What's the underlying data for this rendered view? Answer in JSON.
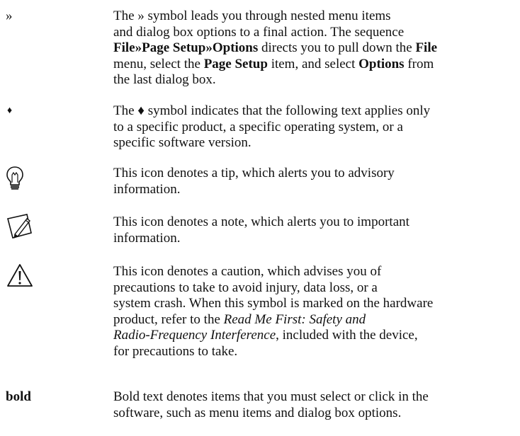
{
  "rows": [
    {
      "label": "»",
      "text": [
        "The » symbol leads you through nested menu items",
        "and dialog box options to a final action. The sequence",
        "File»Page Setup»Options directs you to pull down the File",
        "menu, select the Page Setup item, and select Options from",
        "the last dialog box."
      ]
    },
    {
      "label": "♦",
      "text": [
        "The ♦ symbol indicates that the following text applies only",
        "to a specific product, a specific operating system, or a",
        "specific software version."
      ]
    },
    {
      "icon": "tip-lightbulb-icon",
      "text": [
        "This icon denotes a tip, which alerts you to advisory",
        "information."
      ]
    },
    {
      "icon": "note-pencil-icon",
      "text": [
        "This icon denotes a note, which alerts you to important",
        "information."
      ]
    },
    {
      "icon": "caution-warning-icon",
      "text": [
        "This icon denotes a caution, which advises you of",
        "precautions to take to avoid injury, data loss, or a",
        "system crash. When this symbol is marked on the hardware",
        "product, refer to the Read Me First: Safety and",
        "Radio-Frequency Interference, included with the device,",
        "for precautions to take."
      ]
    },
    {
      "label": "bold",
      "text": [
        "Bold text denotes items that you must select or click in the",
        "software, such as menu items and dialog box options."
      ]
    }
  ],
  "emphasis": {
    "menu_path": "File»Page Setup»Options",
    "menu_file": "File",
    "menu_page_setup": "Page Setup",
    "menu_options": "Options",
    "doc_title": "Read Me First: Safety and Radio-Frequency Interference"
  },
  "colors": {
    "text": "#111111",
    "background": "#ffffff"
  }
}
